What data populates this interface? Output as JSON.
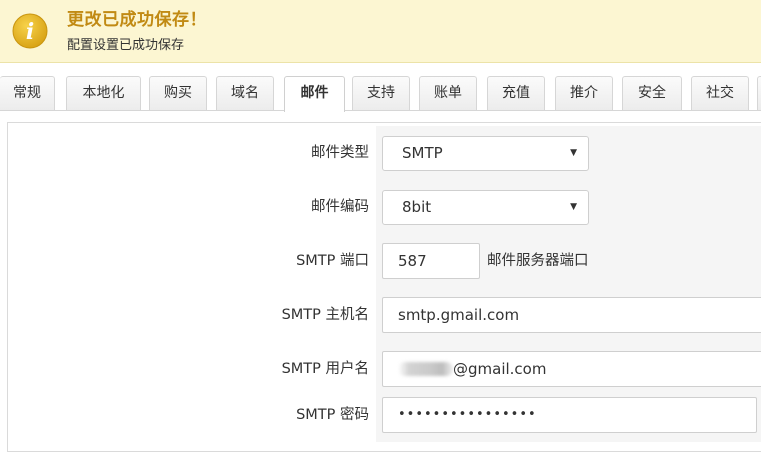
{
  "banner": {
    "title": "更改已成功保存！",
    "message": "配置设置已成功保存",
    "icon": "info-icon",
    "icon_letter": "i",
    "accent_color": "#c18a13",
    "background_color": "#fcf6d2"
  },
  "tabs": [
    {
      "label": "常规",
      "active": false
    },
    {
      "label": "本地化",
      "active": false
    },
    {
      "label": "购买",
      "active": false
    },
    {
      "label": "域名",
      "active": false
    },
    {
      "label": "邮件",
      "active": true
    },
    {
      "label": "支持",
      "active": false
    },
    {
      "label": "账单",
      "active": false
    },
    {
      "label": "充值",
      "active": false
    },
    {
      "label": "推介",
      "active": false
    },
    {
      "label": "安全",
      "active": false
    },
    {
      "label": "社交",
      "active": false
    }
  ],
  "form": {
    "mail_type": {
      "label": "邮件类型",
      "value": "SMTP"
    },
    "mail_encoding": {
      "label": "邮件编码",
      "value": "8bit"
    },
    "smtp_port": {
      "label": "SMTP 端口",
      "value": "587",
      "hint": "邮件服务器端口"
    },
    "smtp_host": {
      "label": "SMTP 主机名",
      "value": "smtp.gmail.com"
    },
    "smtp_user": {
      "label": "SMTP 用户名",
      "value_suffix": "@gmail.com"
    },
    "smtp_password": {
      "label": "SMTP 密码",
      "value": "••••••••••••••••"
    }
  }
}
